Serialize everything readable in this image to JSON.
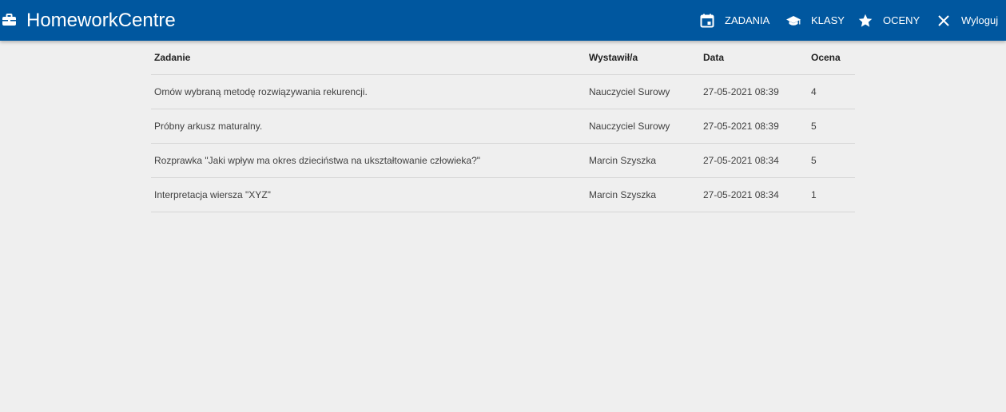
{
  "app": {
    "title": "HomeworkCentre",
    "brand_icon": "briefcase-icon"
  },
  "nav": {
    "items": [
      {
        "label": "ZADANIA",
        "icon": "calendar-icon"
      },
      {
        "label": "KLASY",
        "icon": "graduation-cap-icon"
      },
      {
        "label": "OCENY",
        "icon": "star-icon"
      },
      {
        "label": "Wyloguj",
        "icon": "close-icon"
      }
    ]
  },
  "table": {
    "headers": [
      "Zadanie",
      "Wystawił/a",
      "Data",
      "Ocena"
    ],
    "rows": [
      [
        "Omów wybraną metodę rozwiązywania rekurencji.",
        "Nauczyciel Surowy",
        "27-05-2021 08:39",
        "4"
      ],
      [
        "Próbny arkusz maturalny.",
        "Nauczyciel Surowy",
        "27-05-2021 08:39",
        "5"
      ],
      [
        "Rozprawka \"Jaki wpływ ma okres dzieciństwa na ukształtowanie człowieka?\"",
        "Marcin Szyszka",
        "27-05-2021 08:34",
        "5"
      ],
      [
        "Interpretacja wiersza \"XYZ\"",
        "Marcin Szyszka",
        "27-05-2021 08:34",
        "1"
      ]
    ]
  },
  "colors": {
    "topbar": "#00579f",
    "background": "#efefef",
    "divider": "#d6d6d6"
  }
}
